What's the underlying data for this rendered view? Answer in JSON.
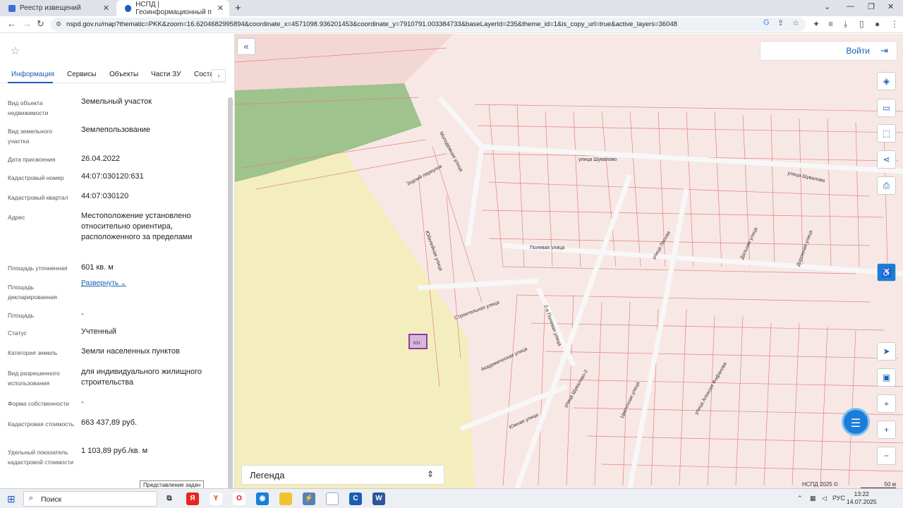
{
  "browser": {
    "tabs": [
      {
        "label": "Реестр извещений",
        "active": false
      },
      {
        "label": "НСПД | Геоинформационный п",
        "active": true
      }
    ],
    "url": "nspd.gov.ru/map?thematic=PKK&zoom=16.6204682995894&coordinate_x=4571098.936201453&coordinate_y=7910791.003384733&baseLayerId=235&theme_id=1&is_copy_url=true&active_layers=36048"
  },
  "sidebar": {
    "tabs": [
      "Информация",
      "Сервисы",
      "Объекты",
      "Части ЗУ",
      "Соста"
    ],
    "rows": [
      {
        "label": "Вид объекта недвижимости",
        "value": "Земельный участок"
      },
      {
        "label": "Вид земельного участка",
        "value": "Землепользование"
      },
      {
        "label": "Дата присвоения",
        "value": "26.04.2022"
      },
      {
        "label": "Кадастровый номер",
        "value": "44:07:030120:631"
      },
      {
        "label": "Кадастровый квартал",
        "value": "44:07:030120"
      },
      {
        "label": "Адрес",
        "value": "Местоположение установлено относительно ориентира, расположенного за пределами"
      },
      {
        "label": "Площадь уточненная",
        "value": "601 кв. м"
      },
      {
        "label": "Площадь декларированная",
        "value": "-"
      },
      {
        "label": "Площадь",
        "value": "-"
      },
      {
        "label": "Статус",
        "value": "Учтенный"
      },
      {
        "label": "Категория земель",
        "value": "Земли населенных пунктов"
      },
      {
        "label": "Вид разрешенного использования",
        "value": "для индивидуального жилищного строительства"
      },
      {
        "label": "Форма собственности",
        "value": "-"
      },
      {
        "label": "Кадастровая стоимость",
        "value": "663 437,89 руб."
      },
      {
        "label": "Удельный показатель кадастровой стоимости",
        "value": "1 103,89 руб./кв. м"
      }
    ],
    "expand_label": "Развернуть"
  },
  "map": {
    "login_label": "Войти",
    "legend_label": "Легенда",
    "copyright": "НСПД 2025 ©",
    "scale": "50 м",
    "streets": [
      "Молодёжная улица",
      "Зодчий переулок",
      "Юбилейная улица",
      "Строительная улица",
      "2-я Полевая улица",
      "Полевая улица",
      "улица Шувалово",
      "улица Шувалово",
      "Академическая улица",
      "улица Горького",
      "Цветочная улица",
      "улица Лесная",
      "улица Алексея Фофанова",
      "Дальняя улица",
      "Дорожная улица",
      "улица Шувалово-2",
      "Южная улица"
    ],
    "highlighted_parcel": "631"
  },
  "taskbar": {
    "search_label": "Поиск",
    "tooltip": "Представление задач",
    "lang": "РУС",
    "time": "13:22",
    "date": "14.07.2025"
  }
}
